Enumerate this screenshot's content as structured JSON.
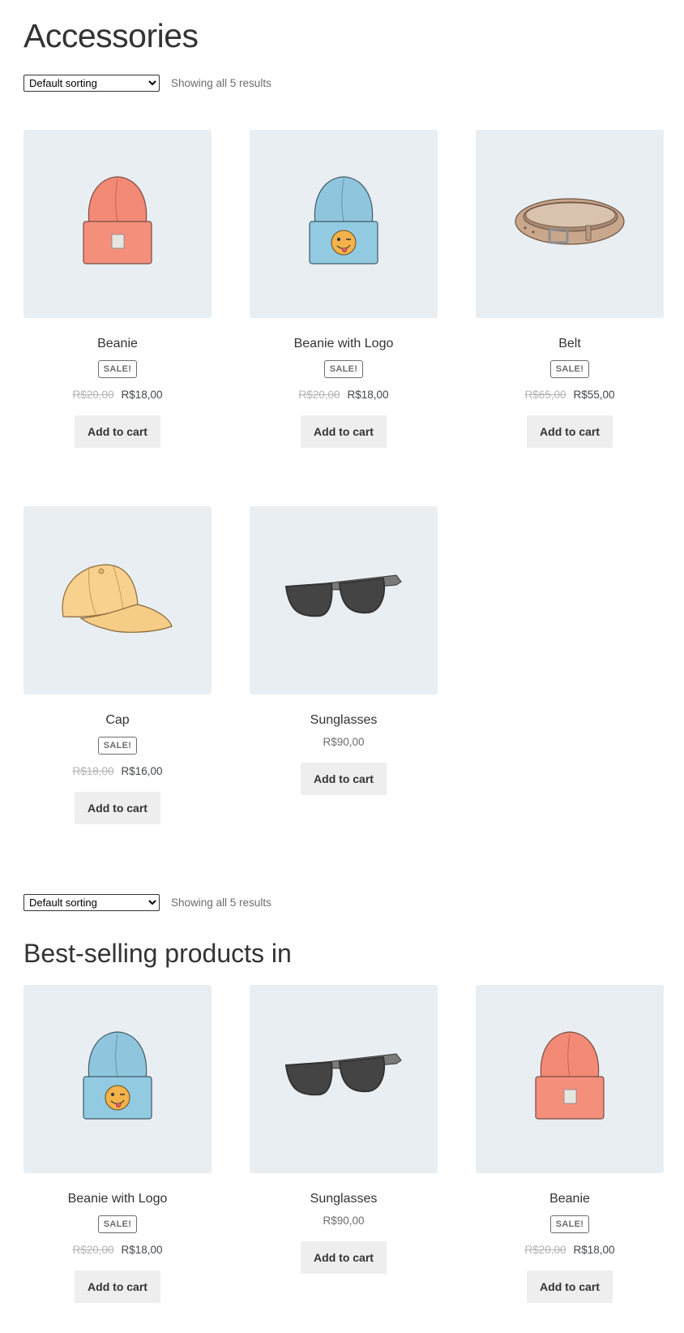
{
  "page": {
    "title": "Accessories"
  },
  "toolbar": {
    "sort_value": "Default sorting",
    "result_count": "Showing all 5 results"
  },
  "products": [
    {
      "name": "Beanie",
      "sale_badge": "SALE!",
      "old_price": "R$20,00",
      "price": "R$18,00",
      "button": "Add to cart",
      "image": "beanie-orange"
    },
    {
      "name": "Beanie with Logo",
      "sale_badge": "SALE!",
      "old_price": "R$20,00",
      "price": "R$18,00",
      "button": "Add to cart",
      "image": "beanie-blue-logo"
    },
    {
      "name": "Belt",
      "sale_badge": "SALE!",
      "old_price": "R$65,00",
      "price": "R$55,00",
      "button": "Add to cart",
      "image": "belt"
    },
    {
      "name": "Cap",
      "sale_badge": "SALE!",
      "old_price": "R$18,00",
      "price": "R$16,00",
      "button": "Add to cart",
      "image": "cap"
    },
    {
      "name": "Sunglasses",
      "price": "R$90,00",
      "button": "Add to cart",
      "image": "sunglasses"
    }
  ],
  "bestsellers": {
    "title": "Best-selling products in",
    "products": [
      {
        "name": "Beanie with Logo",
        "sale_badge": "SALE!",
        "old_price": "R$20,00",
        "price": "R$18,00",
        "button": "Add to cart",
        "image": "beanie-blue-logo"
      },
      {
        "name": "Sunglasses",
        "price": "R$90,00",
        "button": "Add to cart",
        "image": "sunglasses"
      },
      {
        "name": "Beanie",
        "sale_badge": "SALE!",
        "old_price": "R$20,00",
        "price": "R$18,00",
        "button": "Add to cart",
        "image": "beanie-orange"
      }
    ]
  },
  "colors": {
    "thumb_bg": "#e9eef2",
    "button_bg": "#eeeeee",
    "text": "#43454b",
    "muted": "#6d6d6d"
  }
}
